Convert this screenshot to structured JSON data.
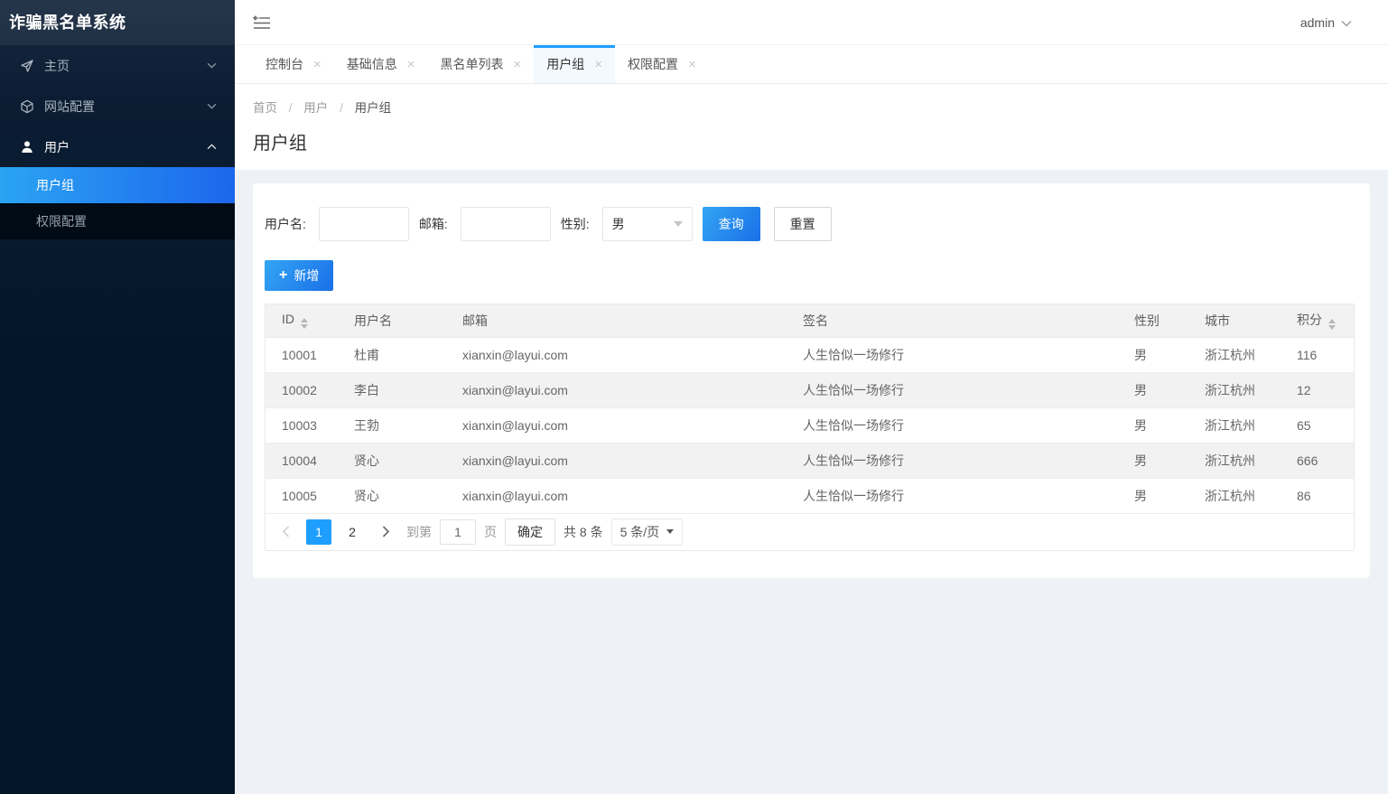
{
  "app": {
    "title": "诈骗黑名单系统",
    "user": "admin"
  },
  "icons": {
    "close": "×",
    "plus": "+"
  },
  "colors": {
    "accent": "#1e9fff",
    "button_gradient_start": "#33a5f3",
    "button_gradient_end": "#1a70e8",
    "sidebar_active_start": "#2ba4f3",
    "sidebar_active_end": "#1d66ec",
    "sidebar_bg": "#011628"
  },
  "sidebar": {
    "items": [
      {
        "label": "主页",
        "icon": "paper-plane-icon"
      },
      {
        "label": "网站配置",
        "icon": "cube-icon"
      },
      {
        "label": "用户",
        "icon": "user-icon",
        "expanded": true
      }
    ],
    "submenu": [
      {
        "label": "用户组",
        "active": true
      },
      {
        "label": "权限配置",
        "active": false
      }
    ]
  },
  "tabs": [
    {
      "label": "控制台",
      "active": false
    },
    {
      "label": "基础信息",
      "active": false
    },
    {
      "label": "黑名单列表",
      "active": false
    },
    {
      "label": "用户组",
      "active": true
    },
    {
      "label": "权限配置",
      "active": false
    }
  ],
  "breadcrumb": {
    "items": [
      "首页",
      "用户",
      "用户组"
    ],
    "separator": "/"
  },
  "page": {
    "title": "用户组"
  },
  "search": {
    "username_label": "用户名:",
    "username_value": "",
    "email_label": "邮箱:",
    "email_value": "",
    "gender_label": "性别:",
    "gender_value": "男",
    "query_label": "查询",
    "reset_label": "重置",
    "add_label": "新增"
  },
  "table": {
    "columns": [
      "ID",
      "用户名",
      "邮箱",
      "签名",
      "性别",
      "城市",
      "积分"
    ],
    "sortable_columns": [
      "ID",
      "积分"
    ],
    "rows": [
      [
        "10001",
        "杜甫",
        "xianxin@layui.com",
        "人生恰似一场修行",
        "男",
        "浙江杭州",
        "116"
      ],
      [
        "10002",
        "李白",
        "xianxin@layui.com",
        "人生恰似一场修行",
        "男",
        "浙江杭州",
        "12"
      ],
      [
        "10003",
        "王勃",
        "xianxin@layui.com",
        "人生恰似一场修行",
        "男",
        "浙江杭州",
        "65"
      ],
      [
        "10004",
        "贤心",
        "xianxin@layui.com",
        "人生恰似一场修行",
        "男",
        "浙江杭州",
        "666"
      ],
      [
        "10005",
        "贤心",
        "xianxin@layui.com",
        "人生恰似一场修行",
        "男",
        "浙江杭州",
        "86"
      ]
    ]
  },
  "pagination": {
    "pages": [
      "1",
      "2"
    ],
    "current": "1",
    "goto_label": "到第",
    "goto_value": "1",
    "page_label": "页",
    "confirm_label": "确定",
    "total_label": "共 8 条",
    "per_page": "5 条/页"
  }
}
